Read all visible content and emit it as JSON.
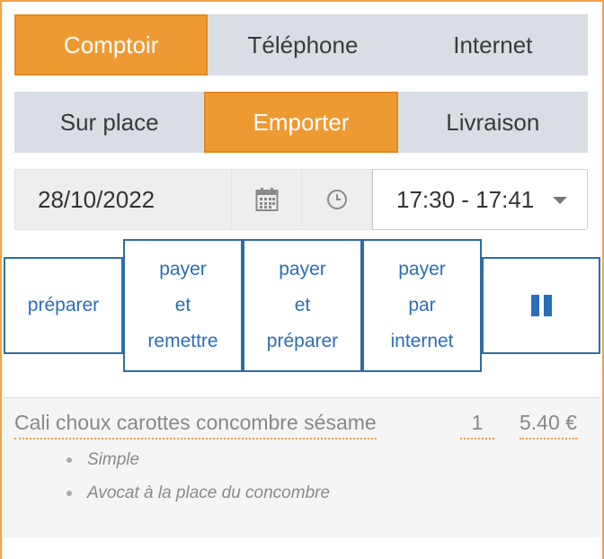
{
  "channel_tabs": [
    {
      "label": "Comptoir",
      "active": true
    },
    {
      "label": "Téléphone",
      "active": false
    },
    {
      "label": "Internet",
      "active": false
    }
  ],
  "mode_tabs": [
    {
      "label": "Sur place",
      "active": false
    },
    {
      "label": "Emporter",
      "active": true
    },
    {
      "label": "Livraison",
      "active": false
    }
  ],
  "schedule": {
    "date": "28/10/2022",
    "date_icon": "calendar-icon",
    "time_icon": "clock-icon",
    "time_slot": "17:30 - 17:41"
  },
  "actions": {
    "prepare": [
      "préparer"
    ],
    "pay_and_remit": [
      "payer",
      "et",
      "remettre"
    ],
    "pay_and_prepare": [
      "payer",
      "et",
      "préparer"
    ],
    "pay_online": [
      "payer",
      "par",
      "internet"
    ],
    "pause_icon": "pause-icon"
  },
  "order": {
    "items": [
      {
        "name": "Cali choux carottes concombre sésame",
        "qty": "1",
        "price": "5.40 €",
        "options": [
          "Simple",
          "Avocat à la place du concombre"
        ]
      }
    ]
  },
  "colors": {
    "accent": "#ee9a33",
    "inactive_tab": "#d8dee4",
    "action_blue": "#2a6ebb"
  }
}
